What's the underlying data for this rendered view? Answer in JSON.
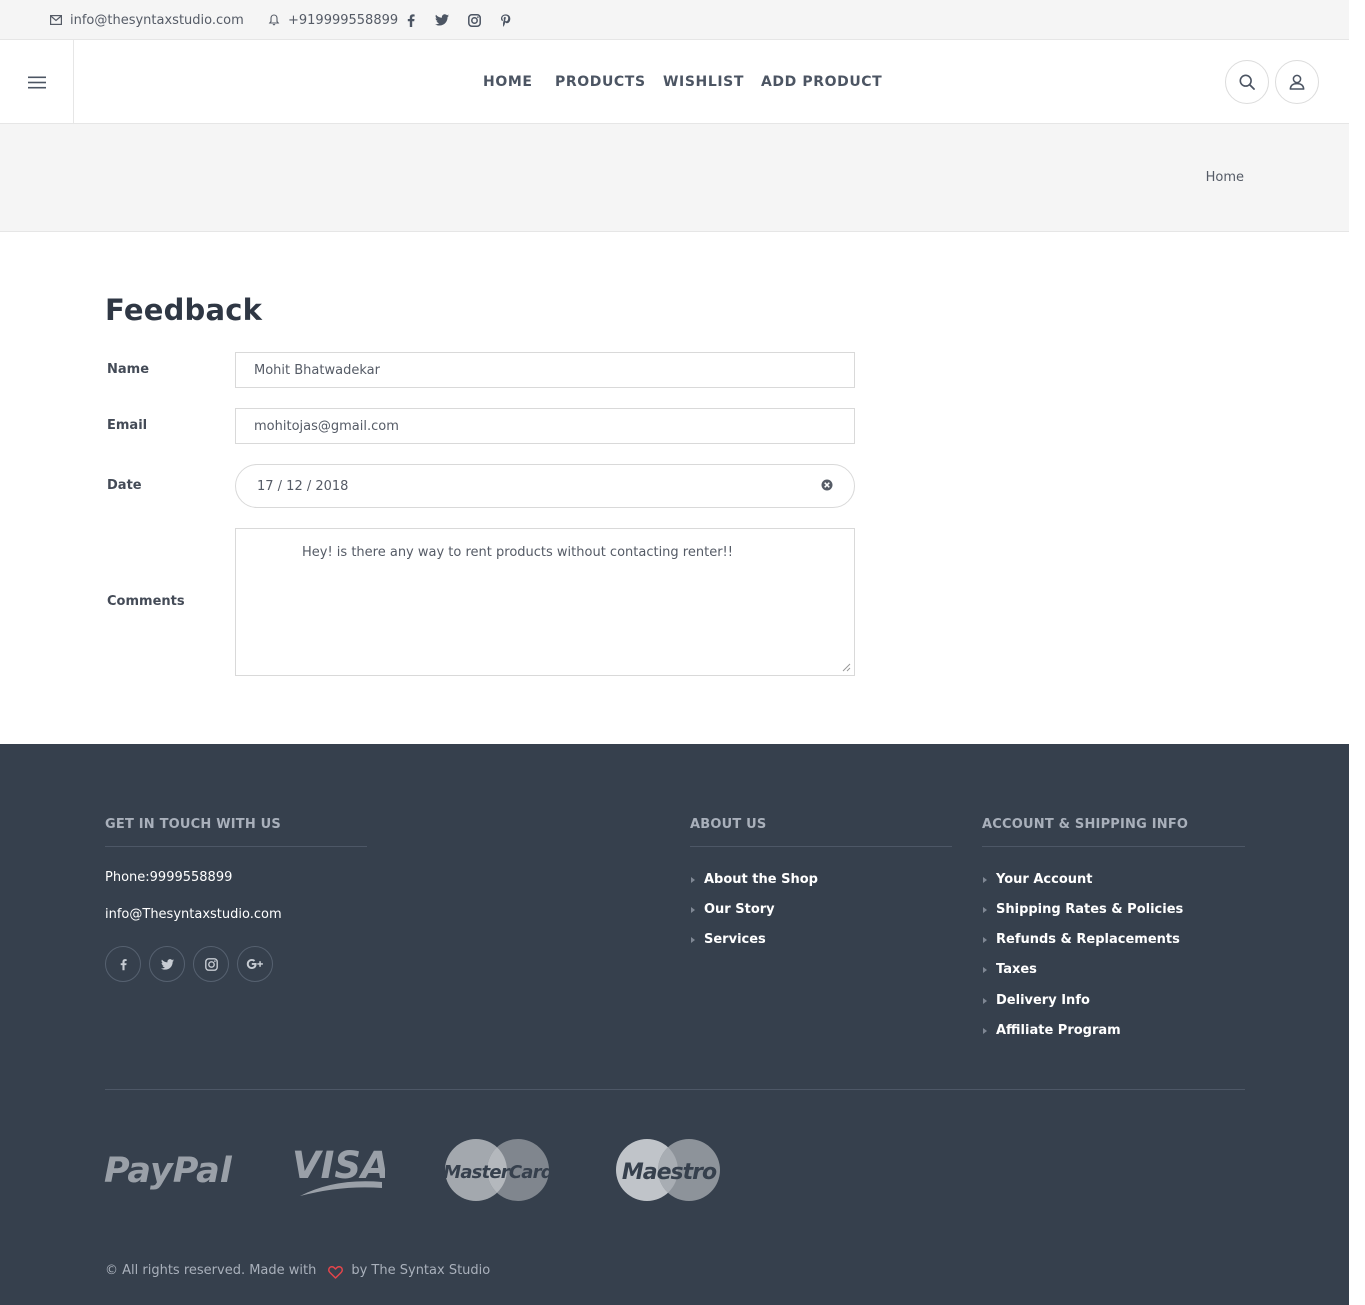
{
  "topbar": {
    "email": "info@thesyntaxstudio.com",
    "phone": "+919999558899",
    "social": [
      "facebook-icon",
      "twitter-icon",
      "instagram-icon",
      "pinterest-icon"
    ]
  },
  "header": {
    "nav": [
      {
        "label": "HOME"
      },
      {
        "label": "PRODUCTS"
      },
      {
        "label": "WISHLIST"
      },
      {
        "label": "ADD PRODUCT"
      }
    ]
  },
  "breadcrumb": {
    "current": "Home"
  },
  "form": {
    "title": "Feedback",
    "name_label": "Name",
    "name_value": "Mohit Bhatwadekar",
    "email_label": "Email",
    "email_value": "mohitojas@gmail.com",
    "date_label": "Date",
    "date_value": "17 / 12 / 2018",
    "comments_label": "Comments",
    "comments_value": "Hey! is there any way to rent products without contacting renter!!"
  },
  "footer": {
    "contact": {
      "heading": "GET IN TOUCH WITH US",
      "phone": "Phone:9999558899",
      "email": "info@Thesyntaxstudio.com"
    },
    "about": {
      "heading": "ABOUT US",
      "links": [
        "About the Shop",
        "Our Story",
        "Services"
      ]
    },
    "account": {
      "heading": "ACCOUNT & SHIPPING INFO",
      "links": [
        "Your Account",
        "Shipping Rates & Policies",
        "Refunds & Replacements",
        "Taxes",
        "Delivery Info",
        "Affiliate Program"
      ]
    },
    "payments": [
      "PayPal",
      "VISA",
      "MasterCard",
      "Maestro"
    ],
    "copyright_prefix": "© All rights reserved. Made with",
    "copyright_suffix": "by The Syntax Studio"
  }
}
